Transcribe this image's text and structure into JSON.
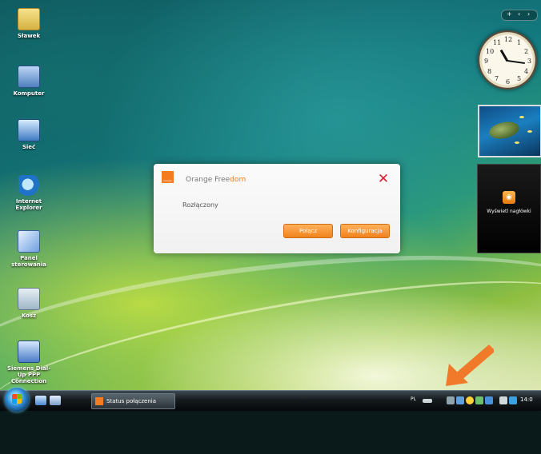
{
  "desktop": {
    "icons": [
      {
        "label": "Sławek",
        "icon": "folder-icon"
      },
      {
        "label": "Komputer",
        "icon": "computer-icon"
      },
      {
        "label": "Sieć",
        "icon": "network-icon"
      },
      {
        "label": "Internet Explorer",
        "icon": "internet-explorer-icon"
      },
      {
        "label": "Panel sterowania",
        "icon": "control-panel-icon"
      },
      {
        "label": "Kosz",
        "icon": "recycle-bin-icon"
      },
      {
        "label": "Siemens Dial-Up PPP Connection",
        "icon": "shortcut-icon"
      }
    ]
  },
  "gadgets": {
    "clock_numbers": [
      "12",
      "1",
      "2",
      "3",
      "4",
      "5",
      "6",
      "7",
      "8",
      "9",
      "10",
      "11"
    ],
    "feed_label": "Wyświetl nagłówki"
  },
  "dialog": {
    "title_part1": "Orange Free",
    "title_part2": "dom",
    "logo_text": "orange",
    "status": "Rozłączony",
    "connect_button": "Połącz",
    "config_button": "Konfiguracja",
    "close_glyph": "✕"
  },
  "taskbar": {
    "task_label": "Status połączenia",
    "language": "PL",
    "time": "14:0"
  },
  "colors": {
    "orange_accent": "#f47b20",
    "arrow": "#f07a2a"
  }
}
